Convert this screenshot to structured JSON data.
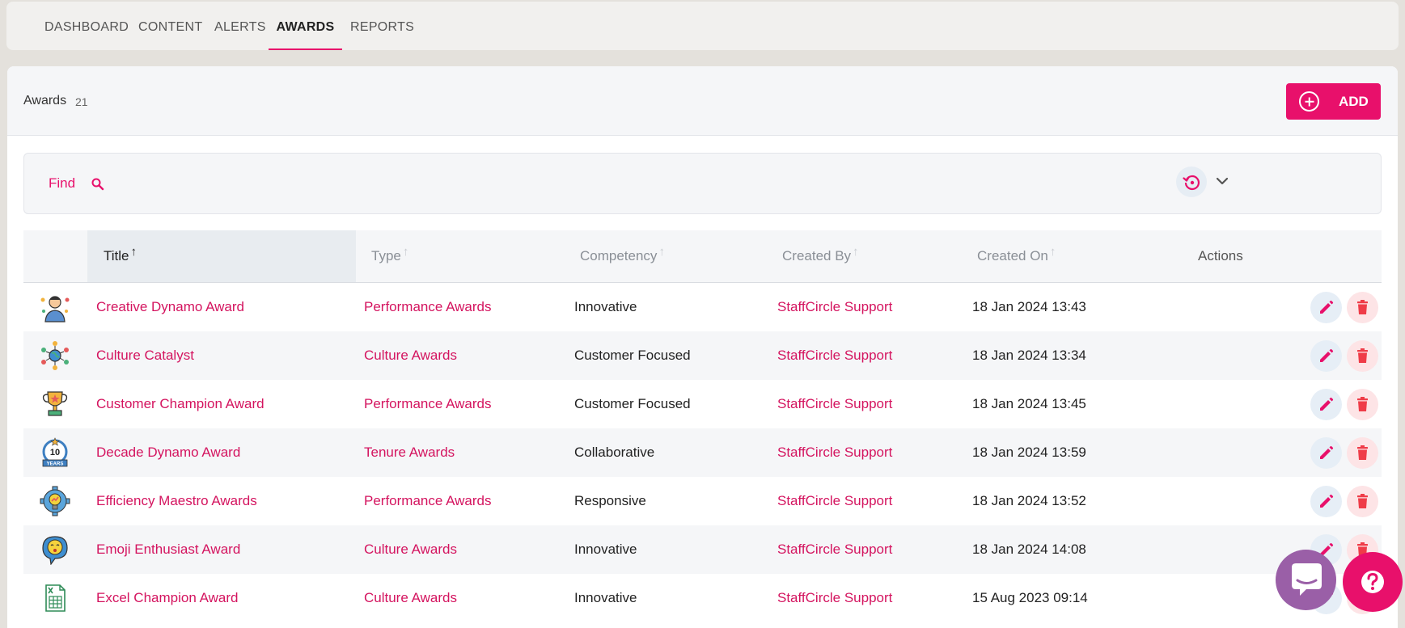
{
  "nav": {
    "tabs": [
      {
        "label": "DASHBOARD"
      },
      {
        "label": "CONTENT"
      },
      {
        "label": "ALERTS"
      },
      {
        "label": "AWARDS",
        "active": true
      },
      {
        "label": "REPORTS"
      }
    ]
  },
  "header": {
    "title": "Awards",
    "count": "21",
    "add_label": "ADD"
  },
  "filter": {
    "find_label": "Find"
  },
  "table": {
    "columns": {
      "title": "Title",
      "type": "Type",
      "competency": "Competency",
      "created_by": "Created By",
      "created_on": "Created On",
      "actions": "Actions"
    },
    "rows": [
      {
        "icon": "creative-dynamo-award-icon",
        "title": "Creative Dynamo Award",
        "type": "Performance Awards",
        "competency": "Innovative",
        "created_by": "StaffCircle Support",
        "created_on": "18 Jan 2024 13:43"
      },
      {
        "icon": "culture-catalyst-icon",
        "title": "Culture Catalyst",
        "type": "Culture Awards",
        "competency": "Customer Focused",
        "created_by": "StaffCircle Support",
        "created_on": "18 Jan 2024 13:34"
      },
      {
        "icon": "trophy-icon",
        "title": "Customer Champion Award",
        "type": "Performance Awards",
        "competency": "Customer Focused",
        "created_by": "StaffCircle Support",
        "created_on": "18 Jan 2024 13:45"
      },
      {
        "icon": "ten-years-badge-icon",
        "title": "Decade Dynamo Award",
        "type": "Tenure Awards",
        "competency": "Collaborative",
        "created_by": "StaffCircle Support",
        "created_on": "18 Jan 2024 13:59",
        "badge_text": "10",
        "badge_sub": "YEARS"
      },
      {
        "icon": "gear-lightbulb-icon",
        "title": "Efficiency Maestro Awards",
        "type": "Performance Awards",
        "competency": "Responsive",
        "created_by": "StaffCircle Support",
        "created_on": "18 Jan 2024 13:52"
      },
      {
        "icon": "emoji-bubble-icon",
        "title": "Emoji Enthusiast Award",
        "type": "Culture Awards",
        "competency": "Innovative",
        "created_by": "StaffCircle Support",
        "created_on": "18 Jan 2024 14:08"
      },
      {
        "icon": "excel-sheet-icon",
        "title": "Excel Champion Award",
        "type": "Culture Awards",
        "competency": "Innovative",
        "created_by": "StaffCircle Support",
        "created_on": "15 Aug 2023 09:14"
      }
    ]
  },
  "colors": {
    "accent": "#e8106b",
    "link": "#d4145f",
    "chat": "#9a5fa7"
  }
}
